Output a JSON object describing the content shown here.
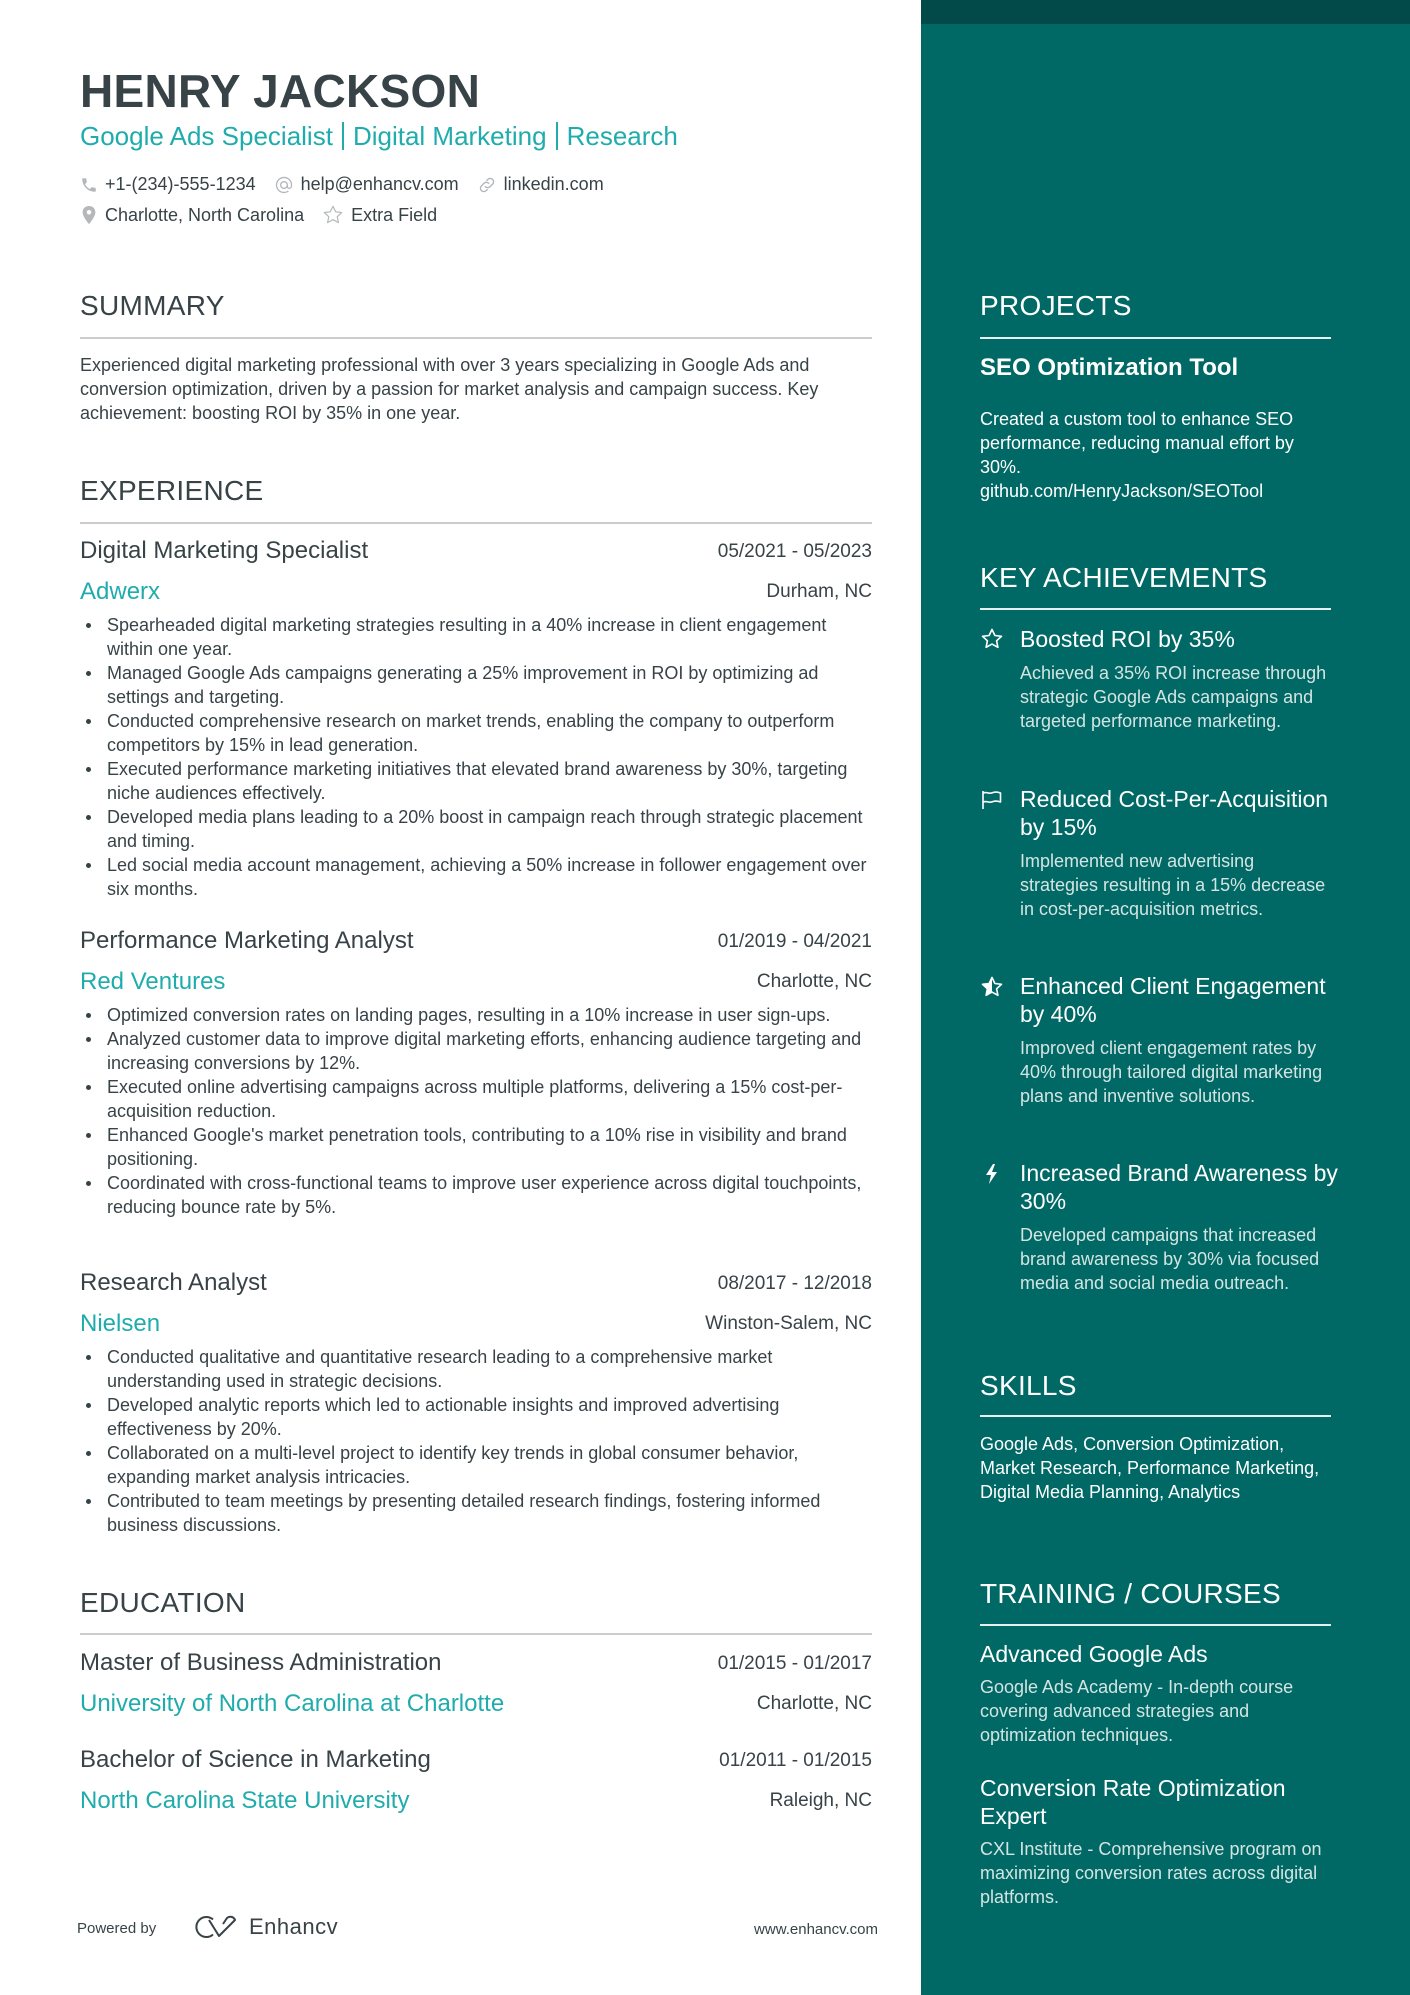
{
  "header": {
    "name": "HENRY JACKSON",
    "titles": [
      "Google Ads Specialist",
      "Digital Marketing",
      "Research"
    ],
    "contacts": {
      "phone": "+1-(234)-555-1234",
      "email": "help@enhancv.com",
      "link": "linkedin.com",
      "location": "Charlotte, North Carolina",
      "extra": "Extra Field"
    }
  },
  "summary": {
    "heading": "SUMMARY",
    "text": "Experienced digital marketing professional with over 3 years specializing in Google Ads and conversion optimization, driven by a passion for market analysis and campaign success. Key achievement: boosting ROI by 35% in one year."
  },
  "experience": {
    "heading": "EXPERIENCE",
    "jobs": [
      {
        "title": "Digital Marketing Specialist",
        "dates": "05/2021 - 05/2023",
        "company": "Adwerx",
        "location": "Durham, NC",
        "bullets": [
          "Spearheaded digital marketing strategies resulting in a 40% increase in client engagement within one year.",
          "Managed Google Ads campaigns generating a 25% improvement in ROI by optimizing ad settings and targeting.",
          "Conducted comprehensive research on market trends, enabling the company to outperform competitors by 15% in lead generation.",
          "Executed performance marketing initiatives that elevated brand awareness by 30%, targeting niche audiences effectively.",
          "Developed media plans leading to a 20% boost in campaign reach through strategic placement and timing.",
          "Led social media account management, achieving a 50% increase in follower engagement over six months."
        ]
      },
      {
        "title": "Performance Marketing Analyst",
        "dates": "01/2019 - 04/2021",
        "company": "Red Ventures",
        "location": "Charlotte, NC",
        "bullets": [
          "Optimized conversion rates on landing pages, resulting in a 10% increase in user sign-ups.",
          "Analyzed customer data to improve digital marketing efforts, enhancing audience targeting and increasing conversions by 12%.",
          "Executed online advertising campaigns across multiple platforms, delivering a 15% cost-per-acquisition reduction.",
          "Enhanced Google's market penetration tools, contributing to a 10% rise in visibility and brand positioning.",
          "Coordinated with cross-functional teams to improve user experience across digital touchpoints, reducing bounce rate by 5%."
        ]
      },
      {
        "title": "Research Analyst",
        "dates": "08/2017 - 12/2018",
        "company": "Nielsen",
        "location": "Winston-Salem, NC",
        "bullets": [
          "Conducted qualitative and quantitative research leading to a comprehensive market understanding used in strategic decisions.",
          "Developed analytic reports which led to actionable insights and improved advertising effectiveness by 20%.",
          "Collaborated on a multi-level project to identify key trends in global consumer behavior, expanding market analysis intricacies.",
          "Contributed to team meetings by presenting detailed research findings, fostering informed business discussions."
        ]
      }
    ]
  },
  "education": {
    "heading": "EDUCATION",
    "items": [
      {
        "degree": "Master of Business Administration",
        "dates": "01/2015 - 01/2017",
        "school": "University of North Carolina at Charlotte",
        "location": "Charlotte, NC"
      },
      {
        "degree": "Bachelor of Science in Marketing",
        "dates": "01/2011 - 01/2015",
        "school": "North Carolina State University",
        "location": "Raleigh, NC"
      }
    ]
  },
  "sidebar": {
    "projects": {
      "heading": "PROJECTS",
      "items": [
        {
          "title": "SEO Optimization Tool",
          "description": "Created a custom tool to enhance SEO performance, reducing manual effort by 30%.",
          "link": "github.com/HenryJackson/SEOTool"
        }
      ]
    },
    "achievements": {
      "heading": "KEY ACHIEVEMENTS",
      "items": [
        {
          "icon": "star-outline-icon",
          "title": "Boosted ROI by 35%",
          "description": "Achieved a 35% ROI increase through strategic Google Ads campaigns and targeted performance marketing."
        },
        {
          "icon": "flag-icon",
          "title": "Reduced Cost-Per-Acquisition by 15%",
          "description": "Implemented new advertising strategies resulting in a 15% decrease in cost-per-acquisition metrics."
        },
        {
          "icon": "half-star-icon",
          "title": "Enhanced Client Engagement by 40%",
          "description": "Improved client engagement rates by 40% through tailored digital marketing plans and inventive solutions."
        },
        {
          "icon": "lightning-icon",
          "title": "Increased Brand Awareness by 30%",
          "description": "Developed campaigns that increased brand awareness by 30% via focused media and social media outreach."
        }
      ]
    },
    "skills": {
      "heading": "SKILLS",
      "text": "Google Ads, Conversion Optimization, Market Research, Performance Marketing, Digital Media Planning, Analytics"
    },
    "training": {
      "heading": "TRAINING / COURSES",
      "items": [
        {
          "title": "Advanced Google Ads",
          "description": "Google Ads Academy - In-depth course covering advanced strategies and optimization techniques."
        },
        {
          "title": "Conversion Rate Optimization Expert",
          "description": "CXL Institute - Comprehensive program on maximizing conversion rates across digital platforms."
        }
      ]
    }
  },
  "footer": {
    "powered_by": "Powered by",
    "brand": "Enhancv",
    "url": "www.enhancv.com"
  },
  "colors": {
    "accent": "#20acac",
    "text": "#384347",
    "sidebar_bg": "#006966",
    "sidebar_top": "#024a4a"
  }
}
